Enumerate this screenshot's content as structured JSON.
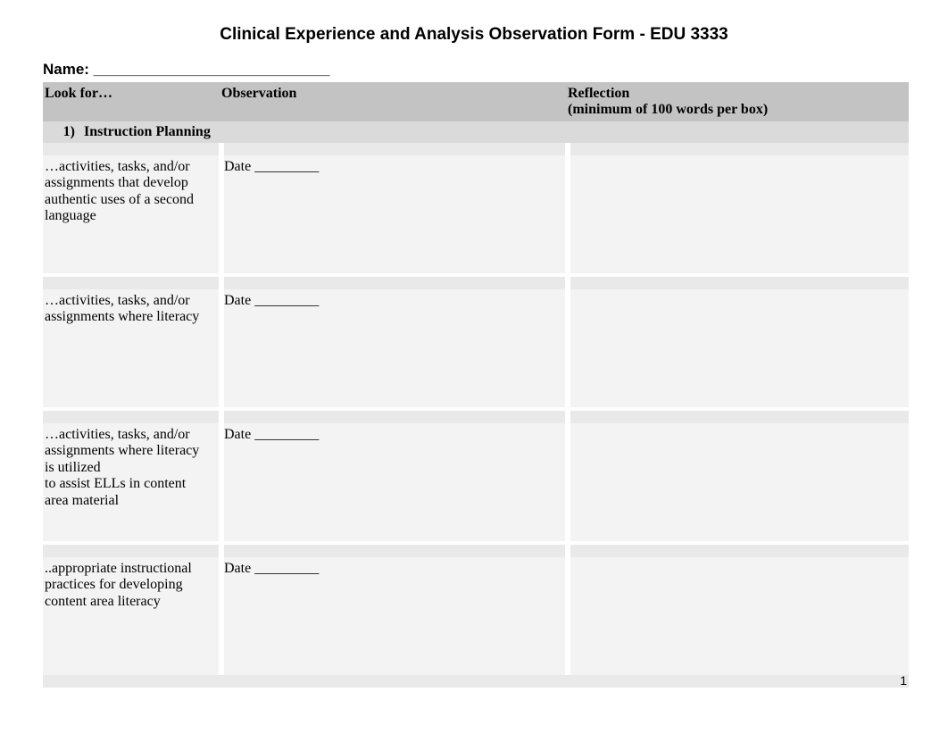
{
  "title": "Clinical Experience and Analysis Observation Form - EDU 3333",
  "name_label": "Name: ____________________________",
  "headers": {
    "lookfor": "Look for…",
    "observation": "Observation",
    "reflection_line1": "Reflection",
    "reflection_line2": "(minimum of 100 words per box)"
  },
  "section": {
    "number": "1)",
    "title": "Instruction Planning"
  },
  "date_field": "Date _________",
  "rows": [
    {
      "lookfor": "…activities, tasks, and/or assignments that develop authentic uses of a second language"
    },
    {
      "lookfor": "…activities, tasks, and/or assignments where literacy"
    },
    {
      "lookfor_line1": "…activities, tasks, and/or assignments where literacy is utilized",
      "lookfor_line2": "to assist ELLs in content area material"
    },
    {
      "lookfor": "..appropriate instructional practices for developing content area literacy"
    }
  ],
  "page_number": "1"
}
